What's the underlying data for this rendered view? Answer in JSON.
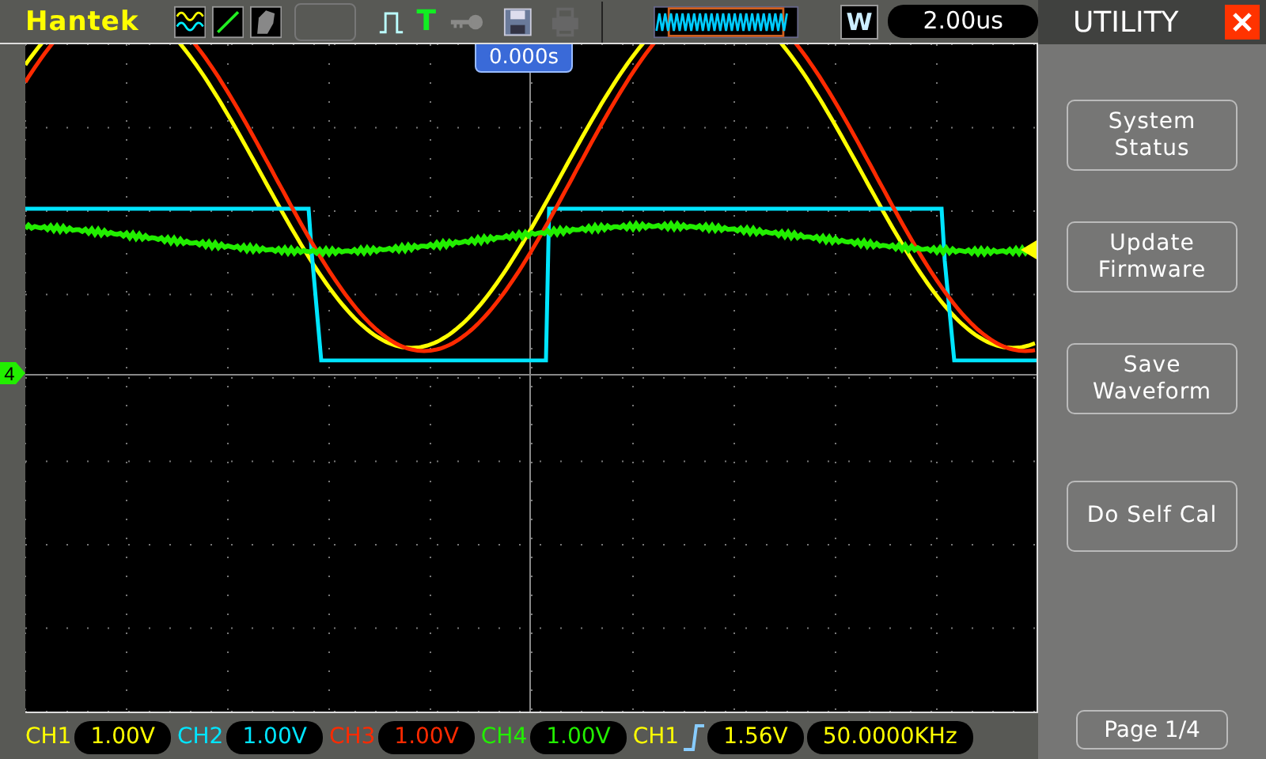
{
  "brand": "Hantek",
  "top_bar": {
    "trigger_indicator": "T",
    "timebase_mode": "W",
    "timebase": "2.00us"
  },
  "trigger_position": "0.000s",
  "ground_marker": "4",
  "channels": [
    {
      "label": "CH1",
      "scale": "1.00V",
      "color": "#ffff00"
    },
    {
      "label": "CH2",
      "scale": "1.00V",
      "color": "#00e5ff"
    },
    {
      "label": "CH3",
      "scale": "1.00V",
      "color": "#ff2a00"
    },
    {
      "label": "CH4",
      "scale": "1.00V",
      "color": "#22ee00"
    }
  ],
  "trigger": {
    "source": "CH1",
    "level": "1.56V",
    "frequency": "50.0000KHz"
  },
  "menu": {
    "title": "UTILITY",
    "buttons": [
      [
        "System",
        "Status"
      ],
      [
        "Update",
        "Firmware"
      ],
      [
        "Save",
        "Waveform"
      ],
      [
        "Do Self Cal"
      ]
    ],
    "page": "Page 1/4"
  }
}
